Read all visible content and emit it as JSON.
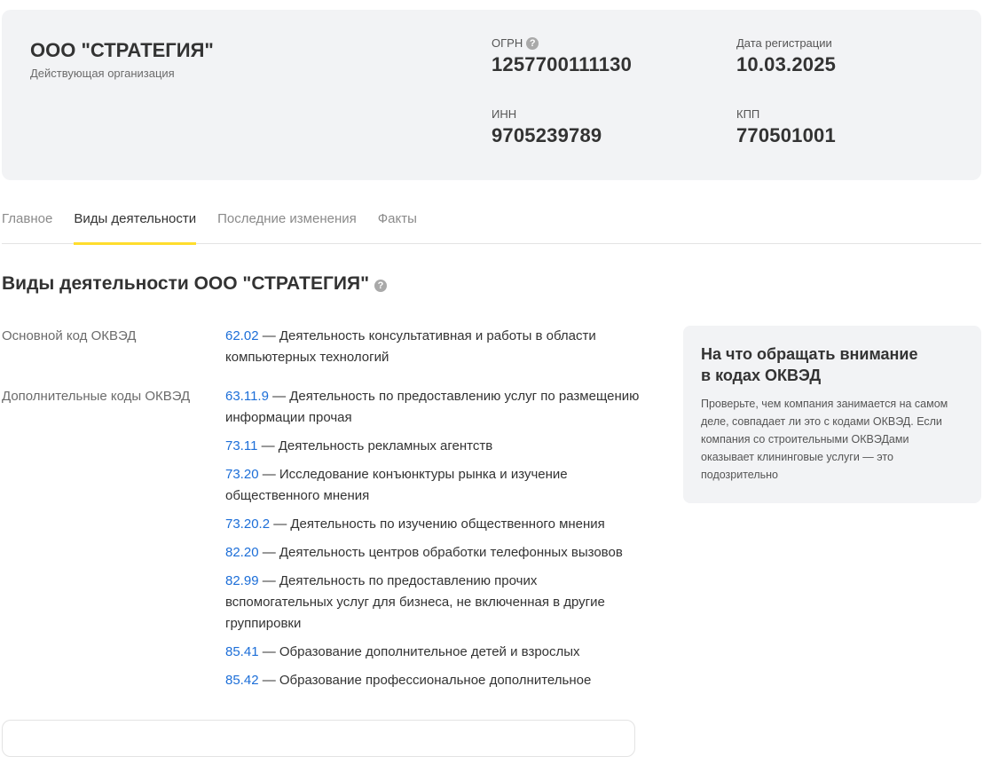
{
  "company": {
    "name": "ООО \"СТРАТЕГИЯ\"",
    "status": "Действующая организация"
  },
  "details": {
    "ogrn_label": "ОГРН",
    "ogrn_value": "1257700111130",
    "reg_date_label": "Дата регистрации",
    "reg_date_value": "10.03.2025",
    "inn_label": "ИНН",
    "inn_value": "9705239789",
    "kpp_label": "КПП",
    "kpp_value": "770501001",
    "help_icon": "?"
  },
  "tabs": [
    {
      "label": "Главное"
    },
    {
      "label": "Виды деятельности"
    },
    {
      "label": "Последние изменения"
    },
    {
      "label": "Факты"
    }
  ],
  "activities": {
    "title": "Виды деятельности ООО \"СТРАТЕГИЯ\"",
    "main_label": "Основной код ОКВЭД",
    "main": [
      {
        "code": "62.02",
        "text": " — Деятельность консультативная и работы в области компьютерных технологий"
      }
    ],
    "extra_label": "Дополнительные коды ОКВЭД",
    "extra": [
      {
        "code": "63.11.9",
        "text": " — Деятельность по предоставлению услуг по размещению информации прочая"
      },
      {
        "code": "73.11",
        "text": " — Деятельность рекламных агентств"
      },
      {
        "code": "73.20",
        "text": " — Исследование конъюнктуры рынка и изучение общественного мнения"
      },
      {
        "code": "73.20.2",
        "text": " — Деятельность по изучению общественного мнения"
      },
      {
        "code": "82.20",
        "text": " — Деятельность центров обработки телефонных вызовов"
      },
      {
        "code": "82.99",
        "text": " — Деятельность по предоставлению прочих вспомогательных услуг для бизнеса, не включенная в другие группировки"
      },
      {
        "code": "85.41",
        "text": " — Образование дополнительное детей и взрослых"
      },
      {
        "code": "85.42",
        "text": " — Образование профессиональное дополнительное"
      }
    ]
  },
  "tip": {
    "title": "На что обращать внимание в кодах ОКВЭД",
    "text": "Проверьте, чем компания занимается на самом деле, совпадает ли это с кодами ОКВЭД. Если компания со строительными ОКВЭДами оказывает клининговые услуги — это подозрительно"
  },
  "colors": {
    "link": "#1c6ed8",
    "accent_underline": "#ffdd2d",
    "card_bg": "#f2f3f5"
  }
}
